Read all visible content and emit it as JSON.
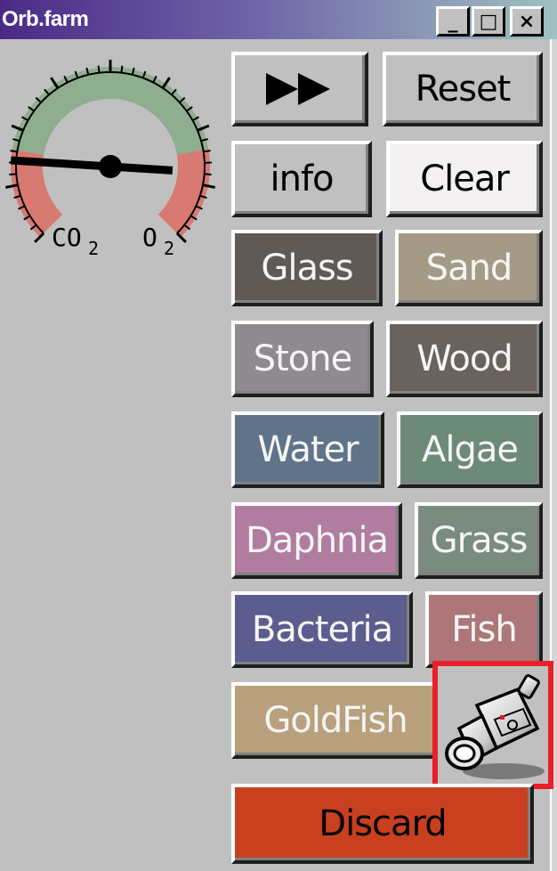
{
  "window": {
    "title": "Orb.farm",
    "minimize_label": "_",
    "maximize_label": "□",
    "close_label": "×"
  },
  "gauge": {
    "left_label": "CO",
    "left_subscript": "2",
    "right_label": "O",
    "right_subscript": "2",
    "needle_level": 0.18
  },
  "buttons": {
    "fast_forward": "▶▶",
    "reset": "Reset",
    "info": "info",
    "clear": "Clear",
    "glass": "Glass",
    "sand": "Sand",
    "stone": "Stone",
    "wood": "Wood",
    "water": "Water",
    "algae": "Algae",
    "daphnia": "Daphnia",
    "grass": "Grass",
    "bacteria": "Bacteria",
    "fish": "Fish",
    "goldfish": "GoldFish",
    "discard": "Discard"
  },
  "colors": {
    "glass": "#5f5a55",
    "sand": "#a59a86",
    "stone": "#8f8a8f",
    "wood": "#6a625c",
    "water": "#5f7488",
    "algae": "#6d8a78",
    "daphnia": "#b07da0",
    "grass": "#7a8c80",
    "bacteria": "#5b5d8f",
    "fish": "#ad7678",
    "goldfish": "#b8a07d",
    "discard": "#c8401f",
    "gauge_green": "#8fae8f",
    "gauge_red": "#d87a72",
    "highlight_border": "#e8202a"
  },
  "icons": {
    "camera": "video-camera-icon"
  }
}
